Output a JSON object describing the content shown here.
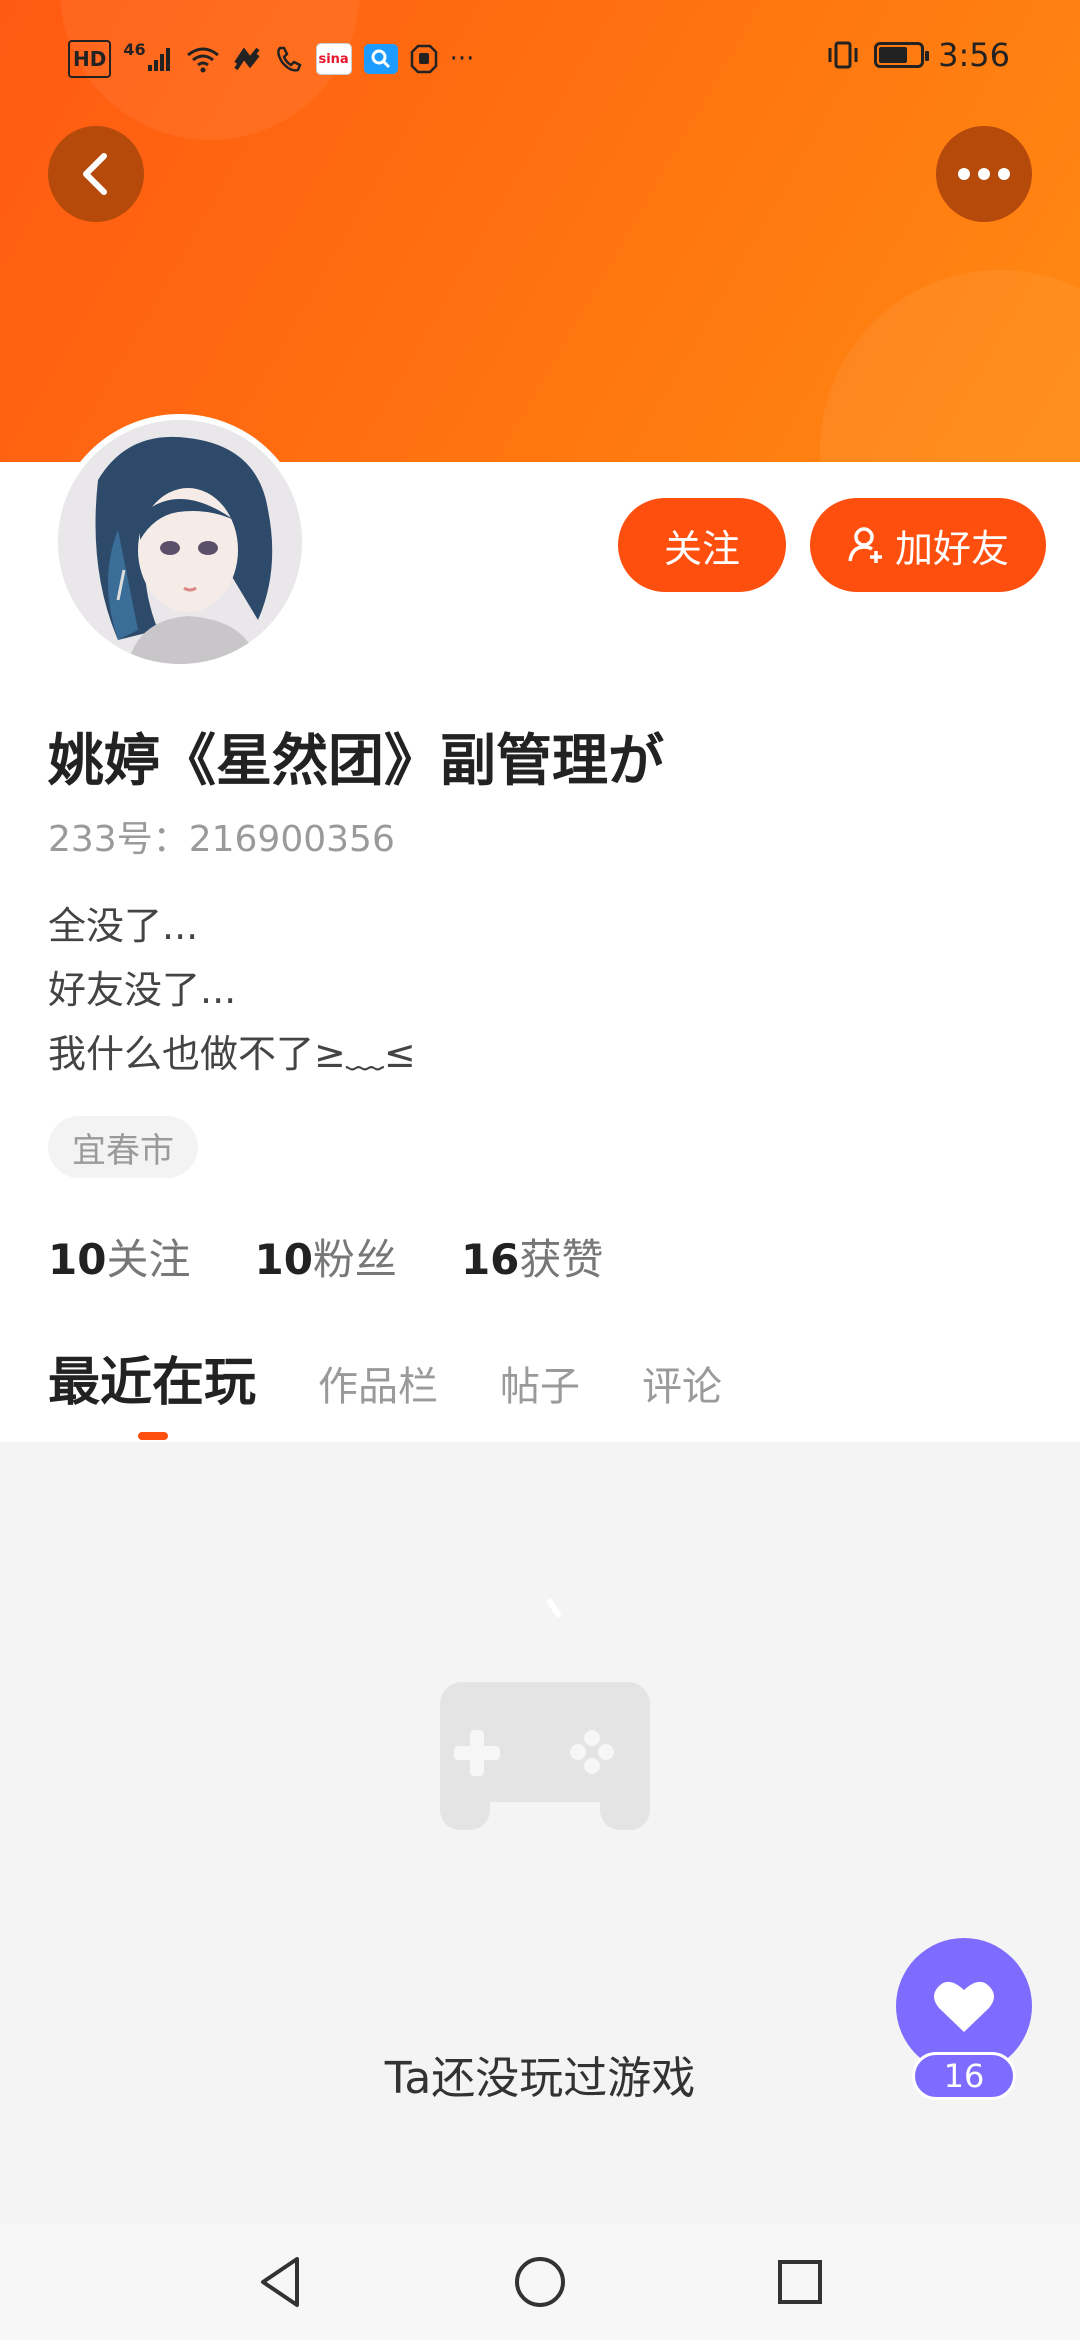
{
  "status_bar": {
    "hd_label": "HD",
    "network_label": "46",
    "time": "3:56",
    "apps": [
      {
        "name": "sina-app-icon",
        "label": "sina",
        "color": "#e6162d"
      },
      {
        "name": "search-app-icon",
        "label": "Q",
        "color": "#1e9bff"
      }
    ],
    "more_indicator": "···"
  },
  "header": {
    "back_icon": "chevron-left-icon",
    "more_icon": "more-horizontal-icon",
    "accent_color": "#ff5a12"
  },
  "profile": {
    "name": "姚婷《星然团》副管理が",
    "id_line": "233号：216900356",
    "bio": [
      "全没了...",
      "好友没了...",
      "我什么也做不了≥﹏≤"
    ],
    "location_tag": "宜春市",
    "follow_label": "关注",
    "add_friend_label": "加好友"
  },
  "stats": [
    {
      "num": "10",
      "label": "关注"
    },
    {
      "num": "10",
      "label": "粉丝"
    },
    {
      "num": "16",
      "label": "获赞"
    }
  ],
  "tabs": [
    {
      "label": "最近在玩",
      "active": true
    },
    {
      "label": "作品栏",
      "active": false
    },
    {
      "label": "帖子",
      "active": false
    },
    {
      "label": "评论",
      "active": false
    }
  ],
  "empty_state": {
    "icon": "gamepad-icon",
    "message": "Ta还没玩过游戏"
  },
  "like_fab": {
    "icon": "heart-icon",
    "count": "16",
    "color": "#7e6bff"
  },
  "nav_bar": {
    "back": "triangle-back-icon",
    "home": "circle-home-icon",
    "recents": "square-recents-icon"
  }
}
